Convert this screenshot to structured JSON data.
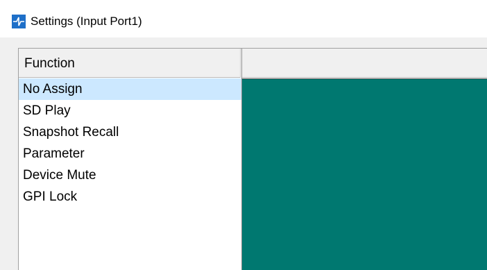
{
  "window": {
    "title": "Settings (Input Port1)"
  },
  "function_list": {
    "header": "Function",
    "selected_index": 0,
    "items": [
      {
        "label": "No Assign"
      },
      {
        "label": "SD Play"
      },
      {
        "label": "Snapshot Recall"
      },
      {
        "label": "Parameter"
      },
      {
        "label": "Device Mute"
      },
      {
        "label": "GPI Lock"
      }
    ]
  },
  "colors": {
    "selection": "#cce8ff",
    "detail_panel": "#007870",
    "app_icon": "#1e6fc8"
  },
  "icons": {
    "app": "app-logo-icon"
  }
}
